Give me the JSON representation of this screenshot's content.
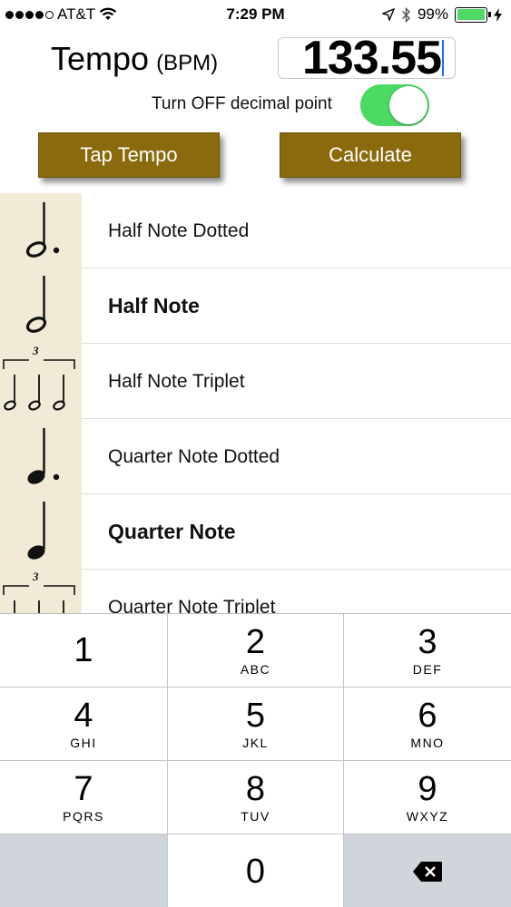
{
  "status_bar": {
    "carrier": "AT&T",
    "time": "7:29 PM",
    "battery": "99%",
    "battery_level": 0.99,
    "signal_bars": 4,
    "signal_max": 5,
    "icons": [
      "wifi-icon",
      "location-arrow-icon",
      "bluetooth-icon",
      "battery-icon",
      "charging-bolt-icon"
    ]
  },
  "tempo": {
    "label": "Tempo",
    "unit": "(BPM)",
    "value": "133.55"
  },
  "decimal_toggle": {
    "label": "Turn OFF decimal point",
    "on": true
  },
  "buttons": {
    "tap_tempo": "Tap Tempo",
    "calculate": "Calculate"
  },
  "notes": [
    {
      "label": "Half Note Dotted",
      "bold": false,
      "icon": "half-note-dotted-icon",
      "triplet_mark": ""
    },
    {
      "label": "Half Note",
      "bold": true,
      "icon": "half-note-icon",
      "triplet_mark": ""
    },
    {
      "label": "Half Note Triplet",
      "bold": false,
      "icon": "half-note-triplet-icon",
      "triplet_mark": "3"
    },
    {
      "label": "Quarter Note Dotted",
      "bold": false,
      "icon": "quarter-note-dotted-icon",
      "triplet_mark": ""
    },
    {
      "label": "Quarter Note",
      "bold": true,
      "icon": "quarter-note-icon",
      "triplet_mark": ""
    },
    {
      "label": "Quarter Note Triplet",
      "bold": false,
      "icon": "quarter-note-triplet-icon",
      "triplet_mark": "3"
    }
  ],
  "keypad": {
    "keys": [
      {
        "digit": "1",
        "letters": ""
      },
      {
        "digit": "2",
        "letters": "ABC"
      },
      {
        "digit": "3",
        "letters": "DEF"
      },
      {
        "digit": "4",
        "letters": "GHI"
      },
      {
        "digit": "5",
        "letters": "JKL"
      },
      {
        "digit": "6",
        "letters": "MNO"
      },
      {
        "digit": "7",
        "letters": "PQRS"
      },
      {
        "digit": "8",
        "letters": "TUV"
      },
      {
        "digit": "9",
        "letters": "WXYZ"
      },
      {
        "digit": "",
        "letters": ""
      },
      {
        "digit": "0",
        "letters": ""
      },
      {
        "digit": "",
        "letters": "",
        "icon": "backspace-icon"
      }
    ]
  },
  "colors": {
    "button_bg": "#8a6a0d",
    "toggle_on": "#4cd964",
    "note_strip": "#f1ead6",
    "caret": "#1a6cff"
  }
}
